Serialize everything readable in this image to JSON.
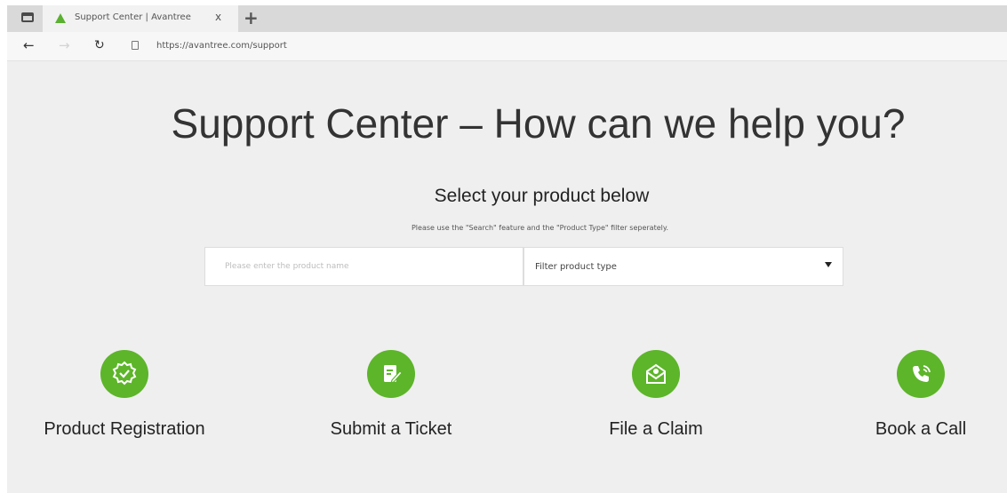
{
  "browser": {
    "tab_title": "Support Center | Avantree",
    "tab_close": "x",
    "new_tab": "+",
    "url": "https://avantree.com/support",
    "back": "←",
    "forward": "→",
    "reload": "↻"
  },
  "page": {
    "headline": "Support Center – How can we help you?",
    "subtitle": "Select your product below",
    "hint": "Please use the \"Search\" feature and the \"Product Type\" filter seperately.",
    "search": {
      "placeholder": "Please enter the product name",
      "value": ""
    },
    "filter": {
      "selected": "Filter product type"
    },
    "actions": [
      {
        "label": "Product Registration",
        "icon": "badge-check-icon"
      },
      {
        "label": "Submit a Ticket",
        "icon": "edit-document-icon"
      },
      {
        "label": "File a Claim",
        "icon": "envelope-icon"
      },
      {
        "label": "Book a Call",
        "icon": "phone-icon"
      }
    ]
  },
  "colors": {
    "accent": "#5db52a",
    "background": "#efefef"
  }
}
